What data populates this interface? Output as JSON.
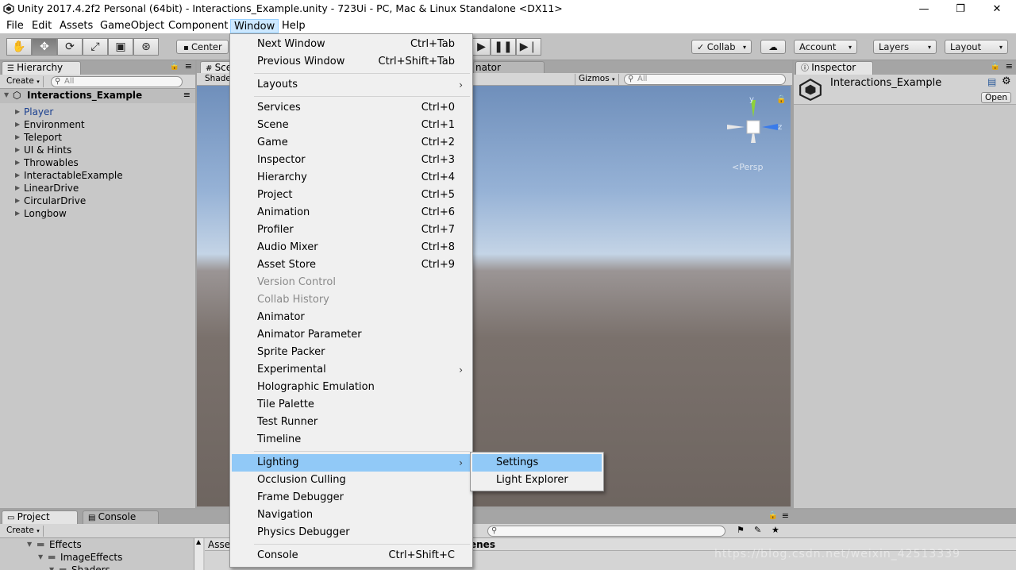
{
  "window": {
    "title": "Unity 2017.4.2f2 Personal (64bit) - Interactions_Example.unity - 723Ui - PC, Mac & Linux Standalone <DX11>",
    "minimize_glyph": "—",
    "maximize_glyph": "❐",
    "close_glyph": "✕"
  },
  "menubar": [
    "File",
    "Edit",
    "Assets",
    "GameObject",
    "Component",
    "Window",
    "Help"
  ],
  "toolbar": {
    "tools": [
      "hand-tool",
      "move-tool",
      "rotate-tool",
      "scale-tool",
      "rect-tool",
      "transform-tool"
    ],
    "pivot_label": "Center",
    "collab_label": "Collab",
    "account_label": "Account",
    "layers_label": "Layers",
    "layout_label": "Layout",
    "dropdown_glyph": "▾"
  },
  "hierarchy": {
    "tab_label": "Hierarchy",
    "create_label": "Create",
    "search_placeholder": "All",
    "scene_name": "Interactions_Example",
    "items": [
      "Player",
      "Environment",
      "Teleport",
      "UI & Hints",
      "Throwables",
      "InteractableExample",
      "LinearDrive",
      "CircularDrive",
      "Longbow"
    ]
  },
  "scene": {
    "tab_label": "Sce",
    "shaded_label": "Shade",
    "animator_label": "nator",
    "gizmos_label": "Gizmos",
    "search_placeholder": "All",
    "persp_label": "Persp",
    "axis_y": "y",
    "axis_z": "z"
  },
  "inspector": {
    "tab_label": "Inspector",
    "object_name": "Interactions_Example",
    "open_label": "Open"
  },
  "project": {
    "project_tab": "Project",
    "console_tab": "Console",
    "create_label": "Create",
    "folders": [
      "Effects",
      "ImageEffects",
      "Shaders"
    ],
    "assets_label": "Asse",
    "scenes_label": "enes"
  },
  "window_menu": {
    "items": [
      {
        "label": "Next Window",
        "shortcut": "Ctrl+Tab"
      },
      {
        "label": "Previous Window",
        "shortcut": "Ctrl+Shift+Tab"
      },
      {
        "label": "Layouts",
        "shortcut": ""
      },
      {
        "label": "Services",
        "shortcut": "Ctrl+0"
      },
      {
        "label": "Scene",
        "shortcut": "Ctrl+1"
      },
      {
        "label": "Game",
        "shortcut": "Ctrl+2"
      },
      {
        "label": "Inspector",
        "shortcut": "Ctrl+3"
      },
      {
        "label": "Hierarchy",
        "shortcut": "Ctrl+4"
      },
      {
        "label": "Project",
        "shortcut": "Ctrl+5"
      },
      {
        "label": "Animation",
        "shortcut": "Ctrl+6"
      },
      {
        "label": "Profiler",
        "shortcut": "Ctrl+7"
      },
      {
        "label": "Audio Mixer",
        "shortcut": "Ctrl+8"
      },
      {
        "label": "Asset Store",
        "shortcut": "Ctrl+9"
      },
      {
        "label": "Version Control",
        "shortcut": ""
      },
      {
        "label": "Collab History",
        "shortcut": ""
      },
      {
        "label": "Animator",
        "shortcut": ""
      },
      {
        "label": "Animator Parameter",
        "shortcut": ""
      },
      {
        "label": "Sprite Packer",
        "shortcut": ""
      },
      {
        "label": "Experimental",
        "shortcut": ""
      },
      {
        "label": "Holographic Emulation",
        "shortcut": ""
      },
      {
        "label": "Tile Palette",
        "shortcut": ""
      },
      {
        "label": "Test Runner",
        "shortcut": ""
      },
      {
        "label": "Timeline",
        "shortcut": ""
      },
      {
        "label": "Lighting",
        "shortcut": ""
      },
      {
        "label": "Occlusion Culling",
        "shortcut": ""
      },
      {
        "label": "Frame Debugger",
        "shortcut": ""
      },
      {
        "label": "Navigation",
        "shortcut": ""
      },
      {
        "label": "Physics Debugger",
        "shortcut": ""
      },
      {
        "label": "Console",
        "shortcut": "Ctrl+Shift+C"
      }
    ],
    "submenu_arrow": "›"
  },
  "lighting_submenu": [
    "Settings",
    "Light Explorer"
  ],
  "watermark": "https://blog.csdn.net/weixin_42513339"
}
